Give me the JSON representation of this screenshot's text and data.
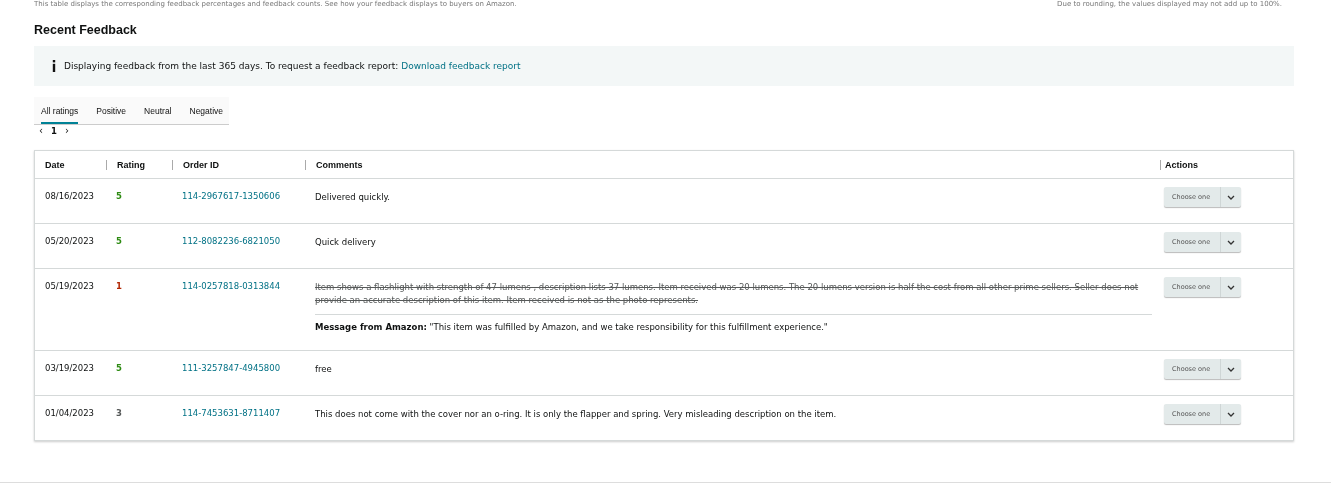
{
  "top_notes": [
    "This table displays the corresponding feedback percentages and feedback counts. See how your feedback displays to buyers on Amazon.",
    "Due to rounding, the values displayed may not add up to 100%."
  ],
  "section_title": "Recent Feedback",
  "info_banner": {
    "text": "Displaying feedback from the last 365 days. To request a feedback report:",
    "link": "Download feedback report"
  },
  "tabs": [
    {
      "label": "All ratings",
      "selected": true
    },
    {
      "label": "Positive",
      "selected": false
    },
    {
      "label": "Neutral",
      "selected": false
    },
    {
      "label": "Negative",
      "selected": false
    }
  ],
  "pagination": {
    "prev": "‹",
    "page": "1",
    "next": "›"
  },
  "table": {
    "columns": [
      "Date",
      "Rating",
      "Order ID",
      "Comments",
      "Actions"
    ],
    "rows": [
      {
        "date": "08/16/2023",
        "rating": "5",
        "color": "#2e8b13",
        "order_id": "114-2967617-1350606",
        "comment": "Delivered quickly.",
        "struck": false,
        "action": "Choose one"
      },
      {
        "date": "05/20/2023",
        "rating": "5",
        "color": "#2e8b13",
        "order_id": "112-8082236-6821050",
        "comment": "Quick delivery",
        "struck": false,
        "action": "Choose one"
      },
      {
        "date": "05/19/2023",
        "rating": "1",
        "color": "#b12704",
        "order_id": "114-0257818-0313844",
        "comment": "Item shows a flashlight with strength of 47 lumens , description lists 37 lumens. Item received was 20 lumens. The 20 lumens version is half the cost from all other prime sellers. Seller does not provide an accurate description of this item. Item received is not as the photo represents.",
        "struck": true,
        "amazon_message": "**Message from Amazon:** \"This item was fulfilled by Amazon, and we take responsibility for this fulfillment experience.\"",
        "action": "Choose one"
      },
      {
        "date": "03/19/2023",
        "rating": "5",
        "color": "#2e8b13",
        "order_id": "111-3257847-4945800",
        "comment": "free",
        "struck": false,
        "action": "Choose one"
      },
      {
        "date": "01/04/2023",
        "rating": "3",
        "color": "#565959",
        "order_id": "114-7453631-8711407",
        "comment": "This does not come with the cover nor an o-ring. It is only the flapper and spring. Very misleading description on the item.",
        "struck": false,
        "action": "Choose one"
      }
    ]
  }
}
